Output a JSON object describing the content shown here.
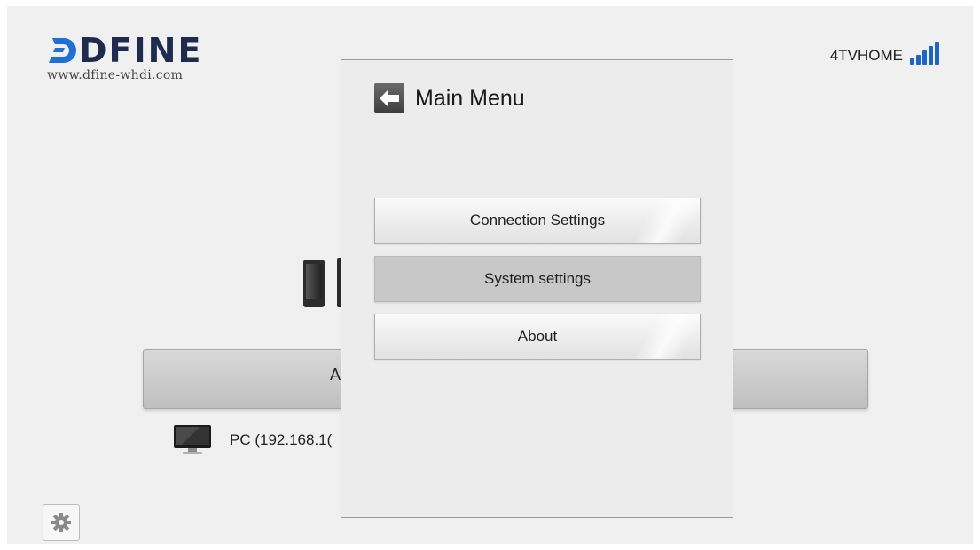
{
  "brand": {
    "name": "DFINE",
    "url": "www.dfine-whdi.com"
  },
  "network": {
    "name": "4TVHOME",
    "signal_level_bars": 5,
    "signal_color": "#1f63c6"
  },
  "background": {
    "bar_label": "A",
    "device_row": {
      "icon": "monitor-icon",
      "label": "PC  (192.168.1("
    },
    "settings_icon": "gear-icon"
  },
  "dialog": {
    "title": "Main Menu",
    "back_icon": "arrow-left-icon",
    "items": [
      {
        "label": "Connection Settings",
        "selected": false
      },
      {
        "label": "System settings",
        "selected": true
      },
      {
        "label": "About",
        "selected": false
      }
    ]
  }
}
